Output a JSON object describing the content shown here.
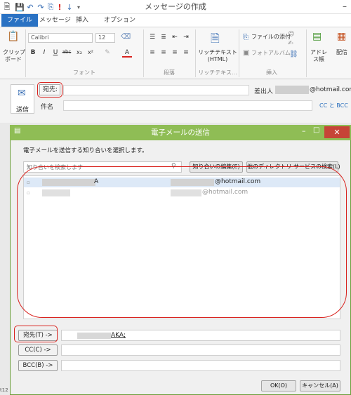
{
  "window": {
    "title": "メッセージの作成"
  },
  "tabs": [
    "ファイル",
    "メッセージ",
    "挿入",
    "オプション"
  ],
  "ribbon": {
    "clipboard_label": "クリップ\nボード",
    "font_group": "フォント",
    "font_name": "Calibri",
    "font_size": "12",
    "paragraph_group": "段落",
    "rich_text": {
      "line1": "リッチテキスト",
      "line2": "(HTML)",
      "group": "リッチテキス..."
    },
    "attach_file": "ファイルの添付",
    "photo_album": "フォトアルバム",
    "insert_group": "挿入",
    "address_book": "アドレ\nス帳",
    "delivery": "配信"
  },
  "compose": {
    "send": "送信",
    "to_button": "宛先:",
    "sender_label": "差出人",
    "sender_value": "@hotmail.com",
    "subject_label": "件名",
    "cc_bcc": "CC と BCC"
  },
  "dialog": {
    "title": "電子メールの送信",
    "instruction": "電子メールを送信する知り合いを選択します。",
    "search_placeholder": "知り合いを検索します",
    "edit_button": "知り合いの編集(E)",
    "dir_search_button": "他のディレクトリ サービスの検索(L)",
    "contacts": [
      {
        "name_suffix": "A",
        "email": "@hotmail.com",
        "selected": true
      },
      {
        "name_suffix": "",
        "email": "@hotmail.com",
        "selected": false
      }
    ],
    "to_button": "宛先(T) ->",
    "to_value": "AKA;",
    "cc_button": "CC(C) ->",
    "bcc_button": "BCC(B) ->",
    "ok_button": "OK(O)",
    "cancel_button": "キャンセル(A)"
  },
  "status": {
    "left_text": "t12"
  },
  "colors": {
    "file_tab": "#2a72c3",
    "dialog_title": "#8fbd55",
    "close": "#c64437",
    "annotation": "#d9231f",
    "link": "#2a6fbd"
  }
}
